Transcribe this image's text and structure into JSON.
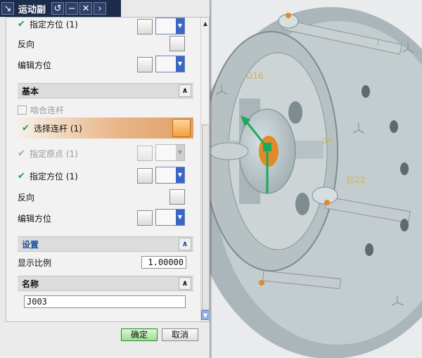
{
  "titlebar": {
    "title": "运动副",
    "icons": [
      "dialog-menu-icon",
      "reset-icon",
      "minimize-icon",
      "close-icon",
      "collapse-arrow-icon"
    ]
  },
  "top_partial": {
    "specify_orientation_label": "指定方位 (1)",
    "reverse_label": "反向",
    "edit_orientation_label": "编辑方位"
  },
  "base_section": {
    "title": "基本",
    "snap_link_label": "啮合连杆",
    "select_link_label": "选择连杆 (1)",
    "specify_origin_label": "指定原点 (1)",
    "specify_orientation_label": "指定方位 (1)",
    "reverse_label": "反向",
    "edit_orientation_label": "编辑方位"
  },
  "settings_section": {
    "title": "设置",
    "display_scale_label": "显示比例",
    "display_scale_value": "1.00000"
  },
  "name_section": {
    "title": "名称",
    "name_value": "J003"
  },
  "footer": {
    "ok_label": "确定",
    "cancel_label": "取消"
  },
  "viewport": {
    "labels": [
      "D16",
      "J022",
      "04",
      "j"
    ],
    "colors": {
      "model": "#b4bfc2",
      "model_dark": "#6c7c80",
      "background": "#e9ebed",
      "accent_green": "#1ea85a",
      "accent_orange": "#e08a2a"
    }
  }
}
